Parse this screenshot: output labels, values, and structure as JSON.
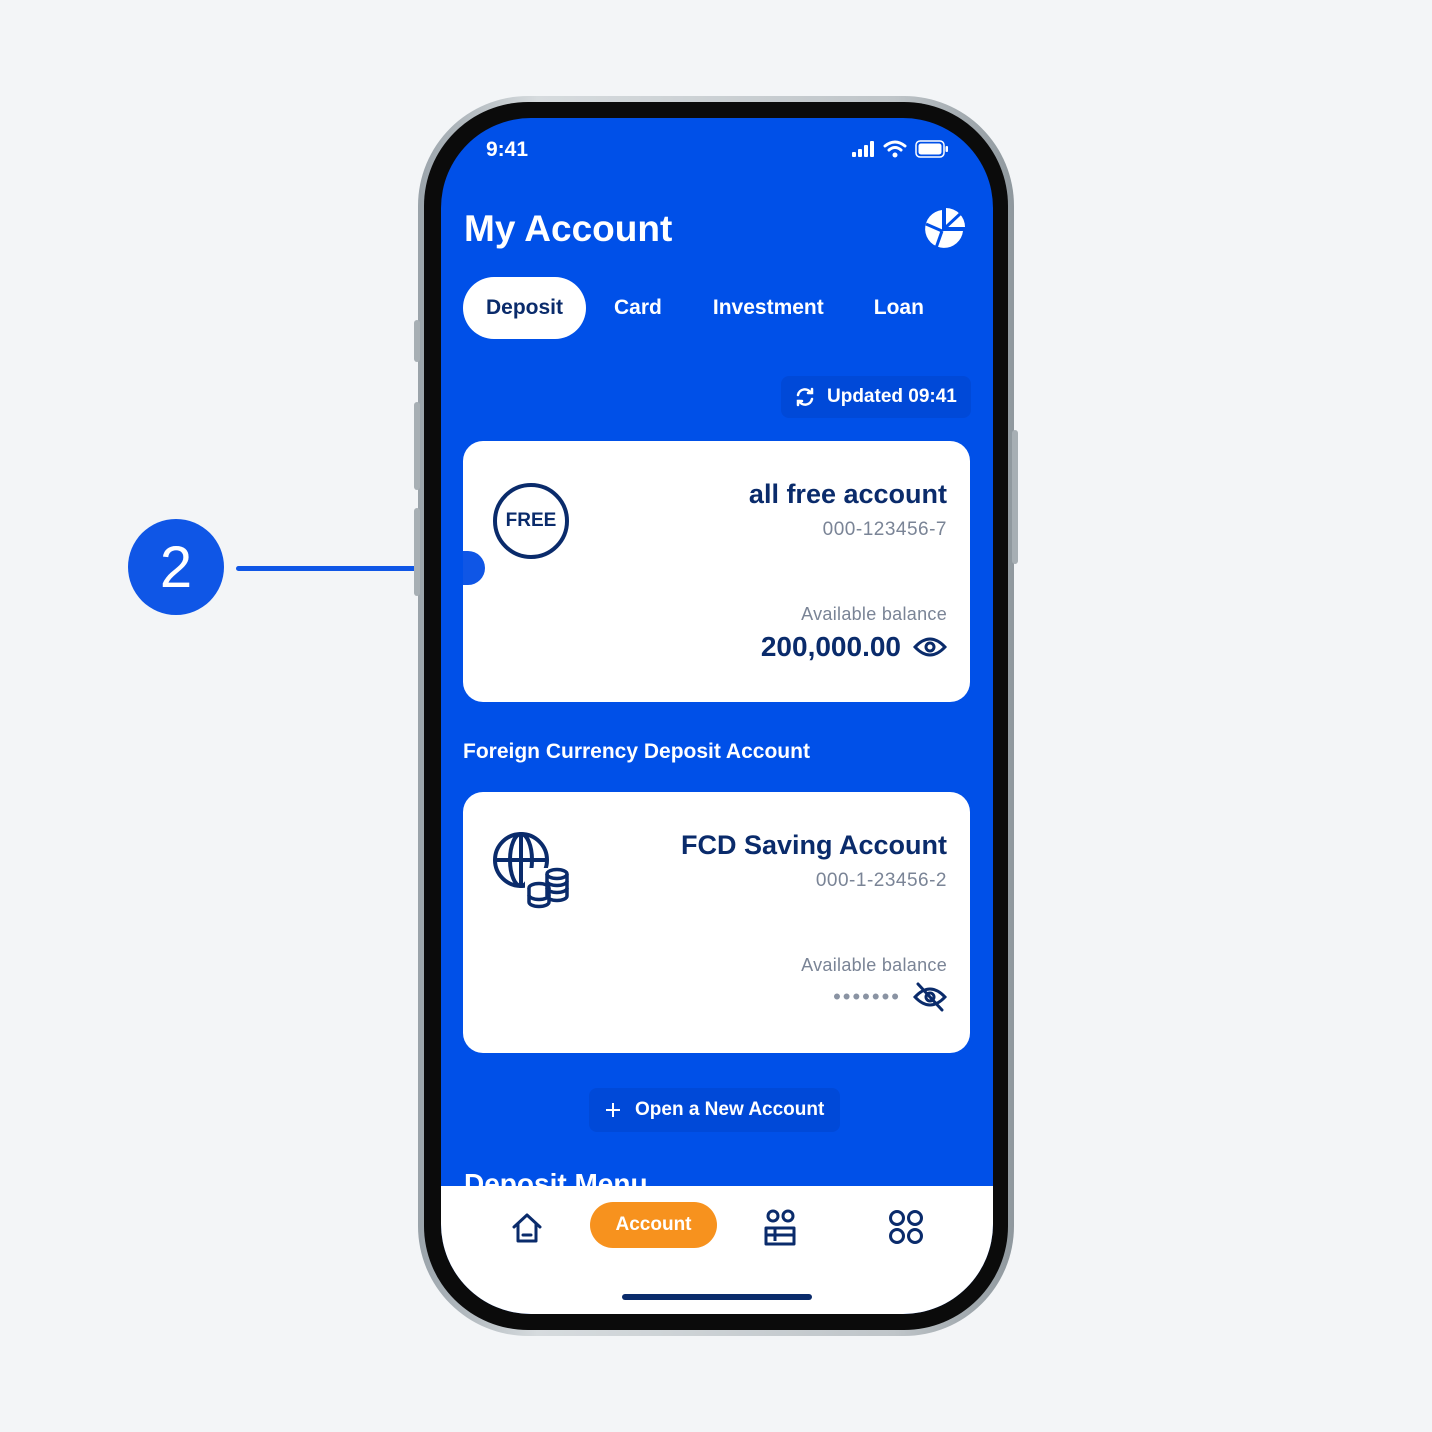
{
  "callout": {
    "number": "2"
  },
  "status_bar": {
    "time": "9:41"
  },
  "header": {
    "title": "My Account",
    "chart_icon": "pie-chart-icon"
  },
  "tabs": [
    {
      "label": "Deposit",
      "active": true
    },
    {
      "label": "Card",
      "active": false
    },
    {
      "label": "Investment",
      "active": false
    },
    {
      "label": "Loan",
      "active": false
    }
  ],
  "updated": {
    "label": "Updated 09:41"
  },
  "accounts": [
    {
      "name": "all free account",
      "number": "000-123456-7",
      "badge": "FREE",
      "balance_label": "Available balance",
      "balance": "200,000.00",
      "balance_visible": true
    },
    {
      "name": "FCD Saving Account",
      "number": "000-1-23456-2",
      "icon": "globe-coins-icon",
      "balance_label": "Available balance",
      "balance": "•••••••",
      "balance_visible": false
    }
  ],
  "sections": {
    "foreign": "Foreign Currency Deposit Account",
    "deposit_menu": "Deposit Menu"
  },
  "actions": {
    "open_account": "Open a New Account"
  },
  "bottom_nav": {
    "account_label": "Account"
  },
  "colors": {
    "primary": "#0050e8",
    "navy": "#0a2b6b",
    "accent": "#f7921e",
    "callout": "#0f56e6"
  }
}
